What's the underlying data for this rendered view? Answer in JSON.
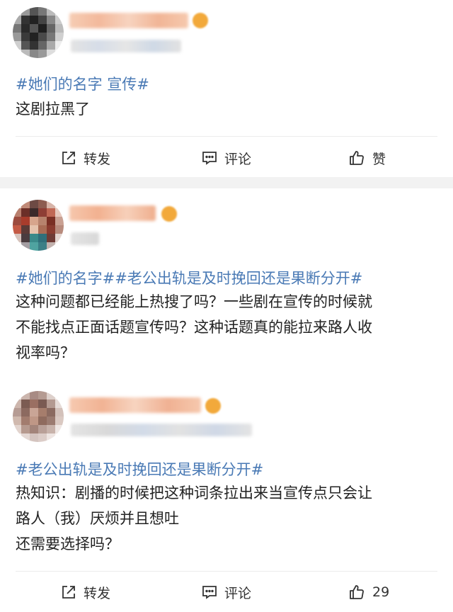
{
  "posts": [
    {
      "topic": "#她们的名字 宣传#",
      "lines": [
        "这剧拉黑了"
      ]
    },
    {
      "topic": "#她们的名字##老公出轨是及时挽回还是果断分开#",
      "lines": [
        "这种问题都已经能上热搜了吗？一些剧在宣传的时候就",
        "不能找点正面话题宣传吗？这种话题真的能拉来路人收",
        "视率吗？"
      ]
    },
    {
      "topic": "#老公出轨是及时挽回还是果断分开#",
      "lines": [
        "热知识：剧播的时候把这种词条拉出来当宣传点只会让",
        "路人（我）厌烦并且想吐",
        "还需要选择吗？"
      ]
    }
  ],
  "actions_top": {
    "repost": "转发",
    "comment": "评论",
    "like": "赞"
  },
  "actions_bottom": {
    "repost": "转发",
    "comment": "评论",
    "like": "29"
  },
  "colors": {
    "topic": "#4a7ab5",
    "separator": "#f2f2f2",
    "icon": "#333333"
  }
}
